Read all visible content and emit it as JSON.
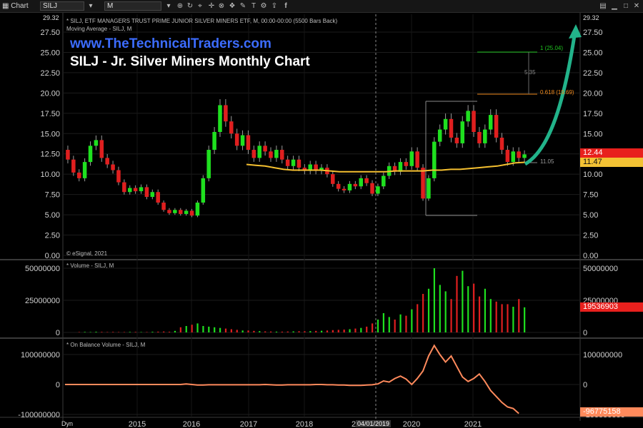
{
  "toolbar": {
    "app_label": "Chart",
    "symbol": "SILJ",
    "interval": "M",
    "share_icon": "facebook-icon",
    "top_right_icons": [
      "grid-icon",
      "minimize-icon",
      "maximize-icon",
      "close-icon"
    ]
  },
  "price_panel": {
    "info_line1": "* SILJ, ETF MANAGERS TRUST PRIME JUNIOR SILVER MINERS ETF, M, 00:00-00:00 (5500 Bars Back)",
    "info_line2": "Moving Average - SILJ, M",
    "watermark_url": "www.TheTechnicalTraders.com",
    "title": "SILJ - Jr. Silver Miners Monthly Chart",
    "copyright": "© eSignal, 2021",
    "axis_top_label": "29.32",
    "y_ticks": [
      "27.50",
      "25.00",
      "22.50",
      "20.00",
      "17.50",
      "15.00",
      "12.50",
      "10.00",
      "7.50",
      "5.00",
      "2.50",
      "0.00"
    ],
    "last_price_badge": "12.44",
    "ma_badge": "11.47",
    "ma_label": "11.05",
    "fib_high_label": "1 (25.04)",
    "fib_mid_label": "0.618 (19.69)",
    "fib_range_label": "5.35",
    "colors": {
      "up": "#1fe01f",
      "down": "#e01f1f",
      "ma": "#f5c030",
      "arrow": "#22b38a",
      "price_badge": "#e8201d",
      "ma_badge": "#f3c234"
    }
  },
  "volume_panel": {
    "label": "* Volume - SILJ, M",
    "y_ticks": [
      "50000000",
      "25000000",
      "0"
    ],
    "last_badge": "19536903"
  },
  "obv_panel": {
    "label": "* On Balance Volume - SILJ, M",
    "y_ticks": [
      "100000000",
      "0",
      "-100000000"
    ],
    "last_badge": "-96775158",
    "line_color": "#ff8a5c"
  },
  "x_axis": {
    "labels": [
      "2015",
      "2016",
      "2017",
      "2018",
      "2020",
      "2021"
    ],
    "cursor_date": "04/01/2019",
    "dyn_label": "Dyn"
  },
  "chart_data": [
    {
      "type": "candlestick",
      "title": "SILJ - Jr. Silver Miners Monthly Chart",
      "ylim": [
        0,
        29.32
      ],
      "x_labels": [
        "2015",
        "2016",
        "2017",
        "2018",
        "2020",
        "2021"
      ],
      "series": [
        {
          "name": "Moving Average - SILJ, M"
        }
      ],
      "last_price": 12.44,
      "ma_value": 11.47,
      "candles": [
        [
          13.0,
          11.8
        ],
        [
          11.8,
          10.2
        ],
        [
          10.2,
          9.5
        ],
        [
          9.5,
          11.5
        ],
        [
          11.5,
          13.5
        ],
        [
          13.5,
          14.2
        ],
        [
          14.2,
          12.0
        ],
        [
          12.0,
          11.2
        ],
        [
          11.2,
          10.5
        ],
        [
          10.5,
          9.0
        ],
        [
          9.0,
          7.8
        ],
        [
          7.8,
          8.3
        ],
        [
          8.3,
          7.9
        ],
        [
          7.9,
          8.4
        ],
        [
          8.4,
          7.2
        ],
        [
          7.2,
          7.8
        ],
        [
          7.8,
          6.5
        ],
        [
          6.5,
          5.6
        ],
        [
          5.6,
          5.2
        ],
        [
          5.2,
          5.6
        ],
        [
          5.6,
          5.1
        ],
        [
          5.1,
          5.5
        ],
        [
          5.5,
          4.9
        ],
        [
          4.9,
          6.5
        ],
        [
          6.5,
          9.5
        ],
        [
          9.5,
          13.0
        ],
        [
          13.0,
          15.2
        ],
        [
          15.2,
          18.5
        ],
        [
          18.5,
          16.5
        ],
        [
          16.5,
          15.0
        ],
        [
          15.0,
          13.5
        ],
        [
          13.5,
          14.8
        ],
        [
          14.8,
          13.0
        ],
        [
          13.0,
          12.0
        ],
        [
          12.0,
          13.5
        ],
        [
          13.5,
          12.8
        ],
        [
          12.8,
          12.0
        ],
        [
          12.0,
          13.0
        ],
        [
          13.0,
          11.8
        ],
        [
          11.8,
          11.0
        ],
        [
          11.0,
          11.8
        ],
        [
          11.8,
          10.8
        ],
        [
          10.8,
          10.4
        ],
        [
          10.4,
          11.2
        ],
        [
          11.2,
          10.4
        ],
        [
          10.4,
          10.8
        ],
        [
          10.8,
          10.0
        ],
        [
          10.0,
          8.8
        ],
        [
          8.8,
          8.2
        ],
        [
          8.2,
          8.0
        ],
        [
          8.0,
          8.8
        ],
        [
          8.8,
          8.5
        ],
        [
          8.5,
          9.5
        ],
        [
          9.5,
          8.9
        ],
        [
          8.9,
          7.6
        ],
        [
          7.6,
          8.5
        ],
        [
          8.5,
          9.8
        ],
        [
          9.8,
          11.0
        ],
        [
          11.0,
          10.3
        ],
        [
          10.3,
          11.5
        ],
        [
          11.5,
          11.0
        ],
        [
          11.0,
          12.8
        ],
        [
          12.8,
          10.8
        ],
        [
          10.8,
          7.0
        ],
        [
          7.0,
          9.5
        ],
        [
          9.5,
          14.0
        ],
        [
          14.0,
          15.5
        ],
        [
          15.5,
          16.8
        ],
        [
          16.8,
          14.5
        ],
        [
          14.5,
          13.8
        ],
        [
          13.8,
          16.5
        ],
        [
          16.5,
          17.8
        ],
        [
          17.8,
          15.2
        ],
        [
          15.2,
          13.8
        ],
        [
          13.8,
          15.5
        ],
        [
          15.5,
          17.3
        ],
        [
          17.3,
          14.5
        ],
        [
          14.5,
          13.0
        ],
        [
          13.0,
          11.5
        ],
        [
          11.5,
          12.8
        ],
        [
          12.8,
          12.0
        ],
        [
          12.0,
          12.44
        ]
      ],
      "ma": [
        11.2,
        11.1,
        11.0,
        10.8,
        10.6,
        10.5,
        10.5,
        10.5,
        10.5,
        10.4,
        10.3,
        10.3,
        10.3,
        10.3,
        10.3,
        10.3,
        10.4,
        10.4,
        10.4,
        10.4,
        10.5,
        10.5,
        10.6,
        10.6,
        10.7,
        10.8,
        10.9,
        11.0,
        11.2,
        11.4,
        11.47
      ]
    },
    {
      "type": "bar",
      "title": "Volume - SILJ, M",
      "ylim": [
        0,
        50000000
      ],
      "values": [
        300000,
        400000,
        300000,
        500000,
        400000,
        300000,
        400000,
        300000,
        300000,
        400000,
        400000,
        300000,
        300000,
        500000,
        600000,
        700000,
        500000,
        1200000,
        4000000,
        5000000,
        6000000,
        7000000,
        5000000,
        4500000,
        4000000,
        3500000,
        3000000,
        2500000,
        2000000,
        1500000,
        1500000,
        1200000,
        1000000,
        800000,
        700000,
        600000,
        600000,
        700000,
        800000,
        900000,
        900000,
        1000000,
        1200000,
        1300000,
        1500000,
        1800000,
        2000000,
        2200000,
        2500000,
        3000000,
        3500000,
        4500000,
        7000000,
        10000000,
        15000000,
        12000000,
        10000000,
        14000000,
        13000000,
        18000000,
        22000000,
        30000000,
        34000000,
        50000000,
        37000000,
        32000000,
        26000000,
        44000000,
        48000000,
        36000000,
        38000000,
        28000000,
        34000000,
        26000000,
        24000000,
        22000000,
        22000000,
        20000000,
        26000000,
        19536903
      ],
      "colors": [
        "green",
        "red"
      ]
    },
    {
      "type": "line",
      "title": "On Balance Volume - SILJ, M",
      "ylim": [
        -100000000,
        120000000
      ],
      "values": [
        0,
        0,
        0,
        0,
        0,
        0,
        0,
        0,
        0,
        0,
        0,
        0,
        0,
        0,
        0,
        0,
        0,
        0,
        0,
        2000000,
        0,
        -2000000,
        -2000000,
        -1000000,
        -1000000,
        -1000000,
        -1000000,
        -1000000,
        -1000000,
        -1000000,
        -1000000,
        -1000000,
        -1000000,
        0,
        -1000000,
        -2000000,
        -2000000,
        -1000000,
        -1000000,
        -1000000,
        -1000000,
        -1000000,
        0,
        0,
        -1000000,
        -1000000,
        -2000000,
        -2000000,
        -3000000,
        -3000000,
        -3000000,
        -2000000,
        -1000000,
        2000000,
        12000000,
        8000000,
        20000000,
        28000000,
        18000000,
        0,
        20000000,
        45000000,
        95000000,
        130000000,
        100000000,
        75000000,
        95000000,
        60000000,
        25000000,
        10000000,
        20000000,
        35000000,
        10000000,
        -20000000,
        -40000000,
        -60000000,
        -75000000,
        -80000000,
        -96775158
      ]
    }
  ]
}
